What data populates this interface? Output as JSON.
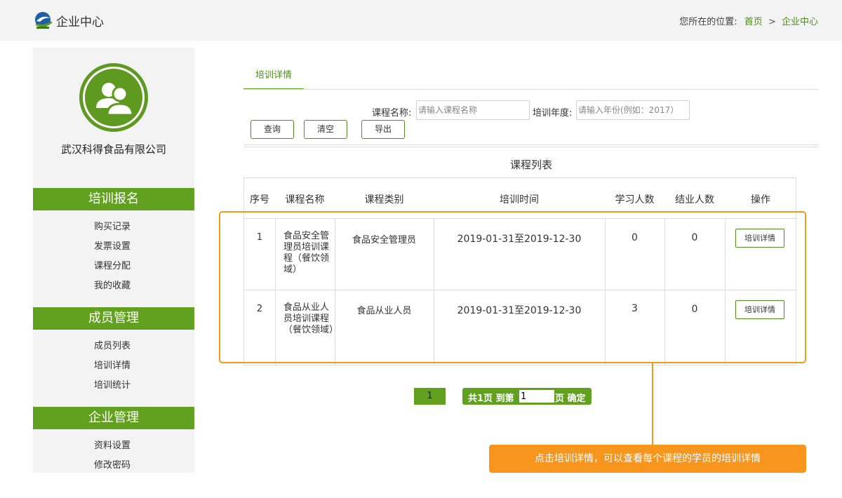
{
  "header": {
    "title": "企业中心",
    "breadcrumb_label": "您所在的位置:",
    "breadcrumb": [
      "首页",
      "企业中心"
    ],
    "breadcrumb_sep": ">"
  },
  "sidebar": {
    "company": "武汉科得食品有限公司",
    "sections": [
      {
        "title": "培训报名",
        "items": [
          "购买记录",
          "发票设置",
          "课程分配",
          "我的收藏"
        ]
      },
      {
        "title": "成员管理",
        "items": [
          "成员列表",
          "培训详情",
          "培训统计"
        ]
      },
      {
        "title": "企业管理",
        "items": [
          "资料设置",
          "修改密码"
        ]
      }
    ]
  },
  "tab": {
    "label": "培训详情"
  },
  "search": {
    "course_label": "课程名称:",
    "course_placeholder": "请输入课程名称",
    "year_label": "培训年度:",
    "year_placeholder": "请输入年份(例如：2017）",
    "query_button": "查询",
    "clear_button": "清空",
    "export_button": "导出"
  },
  "table": {
    "title": "课程列表",
    "headers": [
      "序号",
      "课程名称",
      "课程类别",
      "培训时间",
      "学习人数",
      "结业人数",
      "操作"
    ],
    "rows": [
      {
        "index": "1",
        "name": "食品安全管理员培训课程（餐饮领域）",
        "category": "食品安全管理员",
        "time": "2019-01-31至2019-12-30",
        "learners": "0",
        "graduates": "0",
        "action": "培训详情"
      },
      {
        "index": "2",
        "name": "食品从业人员培训课程（餐饮领域）",
        "category": "食品从业人员",
        "time": "2019-01-31至2019-12-30",
        "learners": "3",
        "graduates": "0",
        "action": "培训详情"
      }
    ]
  },
  "pagination": {
    "current": "1",
    "summary": "共1页 到第",
    "input_value": "1",
    "suffix": "页 确定"
  },
  "callout": "点击培训详情，可以查看每个课程的学员的培训详情",
  "colors": {
    "brand_green": "#62a020",
    "highlight_orange": "#f39a1e"
  }
}
